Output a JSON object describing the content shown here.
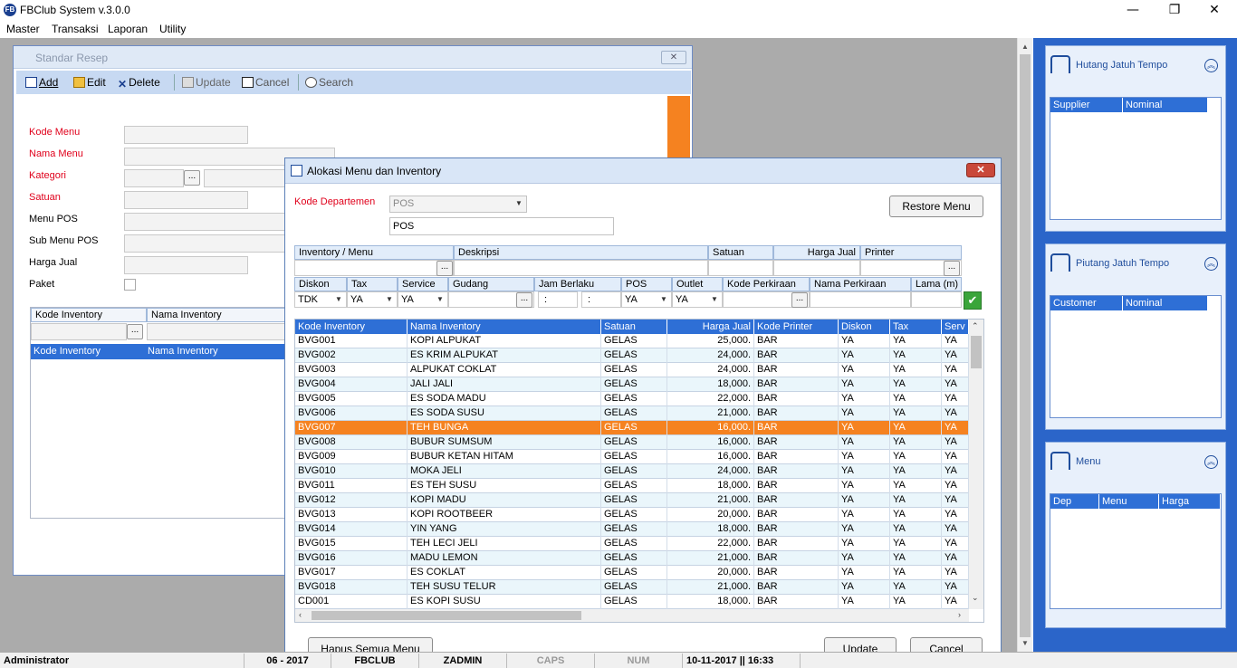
{
  "app": {
    "title": "FBClub System v.3.0.0",
    "min": "—",
    "restore": "❐",
    "close": "✕",
    "icon_text": "FB"
  },
  "menu": [
    "Master",
    "Transaksi",
    "Laporan",
    "Utility"
  ],
  "standar_resep": {
    "title": "Standar Resep",
    "close": "✕",
    "toolbar": {
      "add": "Add",
      "edit": "Edit",
      "delete": "Delete",
      "update": "Update",
      "cancel": "Cancel",
      "search": "Search"
    },
    "fields": {
      "kode_menu": "Kode Menu",
      "nama_menu": "Nama Menu",
      "kategori": "Kategori",
      "satuan": "Satuan",
      "menu_pos": "Menu POS",
      "sub_menu_pos": "Sub Menu POS",
      "harga_jual": "Harga Jual",
      "paket": "Paket"
    },
    "ellipsis": "...",
    "inv_headers": {
      "kode": "Kode Inventory",
      "nama": "Nama Inventory"
    }
  },
  "dialog": {
    "title": "Alokasi Menu dan Inventory",
    "close": "✕",
    "kode_departemen_label": "Kode Departemen",
    "kode_departemen_value": "POS",
    "pos_text": "POS",
    "restore_menu": "Restore Menu",
    "row1_headers": {
      "inventory": "Inventory / Menu",
      "deskripsi": "Deskripsi",
      "satuan": "Satuan",
      "harga_jual": "Harga Jual",
      "printer": "Printer"
    },
    "row2_headers": {
      "diskon": "Diskon",
      "tax": "Tax",
      "service": "Service",
      "gudang": "Gudang",
      "jam": "Jam Berlaku",
      "pos": "POS",
      "outlet": "Outlet",
      "kode_perkiraan": "Kode Perkiraan",
      "nama_perkiraan": "Nama Perkiraan",
      "lama": "Lama (m)"
    },
    "row2_values": {
      "diskon": "TDK",
      "tax": "YA",
      "service": "YA",
      "jam1": ":",
      "jam2": ":",
      "pos": "YA",
      "outlet": "YA"
    },
    "ellipsis": "...",
    "check": "✔",
    "grid_headers": [
      "Kode Inventory",
      "Nama Inventory",
      "Satuan",
      "Harga Jual",
      "Kode Printer",
      "Diskon",
      "Tax",
      "Serv"
    ],
    "grid_rows": [
      [
        "BVG001",
        "KOPI ALPUKAT",
        "GELAS",
        "25,000.",
        "BAR",
        "YA",
        "YA",
        "YA"
      ],
      [
        "BVG002",
        "ES KRIM ALPUKAT",
        "GELAS",
        "24,000.",
        "BAR",
        "YA",
        "YA",
        "YA"
      ],
      [
        "BVG003",
        "ALPUKAT COKLAT",
        "GELAS",
        "24,000.",
        "BAR",
        "YA",
        "YA",
        "YA"
      ],
      [
        "BVG004",
        "JALI JALI",
        "GELAS",
        "18,000.",
        "BAR",
        "YA",
        "YA",
        "YA"
      ],
      [
        "BVG005",
        "ES SODA MADU",
        "GELAS",
        "22,000.",
        "BAR",
        "YA",
        "YA",
        "YA"
      ],
      [
        "BVG006",
        "ES SODA SUSU",
        "GELAS",
        "21,000.",
        "BAR",
        "YA",
        "YA",
        "YA"
      ],
      [
        "BVG007",
        "TEH BUNGA",
        "GELAS",
        "16,000.",
        "BAR",
        "YA",
        "YA",
        "YA"
      ],
      [
        "BVG008",
        "BUBUR SUMSUM",
        "GELAS",
        "16,000.",
        "BAR",
        "YA",
        "YA",
        "YA"
      ],
      [
        "BVG009",
        "BUBUR KETAN HITAM",
        "GELAS",
        "16,000.",
        "BAR",
        "YA",
        "YA",
        "YA"
      ],
      [
        "BVG010",
        "MOKA JELI",
        "GELAS",
        "24,000.",
        "BAR",
        "YA",
        "YA",
        "YA"
      ],
      [
        "BVG011",
        "ES TEH SUSU",
        "GELAS",
        "18,000.",
        "BAR",
        "YA",
        "YA",
        "YA"
      ],
      [
        "BVG012",
        "KOPI MADU",
        "GELAS",
        "21,000.",
        "BAR",
        "YA",
        "YA",
        "YA"
      ],
      [
        "BVG013",
        "KOPI ROOTBEER",
        "GELAS",
        "20,000.",
        "BAR",
        "YA",
        "YA",
        "YA"
      ],
      [
        "BVG014",
        "YIN YANG",
        "GELAS",
        "18,000.",
        "BAR",
        "YA",
        "YA",
        "YA"
      ],
      [
        "BVG015",
        "TEH LECI JELI",
        "GELAS",
        "22,000.",
        "BAR",
        "YA",
        "YA",
        "YA"
      ],
      [
        "BVG016",
        "MADU LEMON",
        "GELAS",
        "21,000.",
        "BAR",
        "YA",
        "YA",
        "YA"
      ],
      [
        "BVG017",
        "ES COKLAT",
        "GELAS",
        "20,000.",
        "BAR",
        "YA",
        "YA",
        "YA"
      ],
      [
        "BVG018",
        "TEH SUSU TELUR",
        "GELAS",
        "21,000.",
        "BAR",
        "YA",
        "YA",
        "YA"
      ],
      [
        "CD001",
        "ES KOPI SUSU",
        "GELAS",
        "18,000.",
        "BAR",
        "YA",
        "YA",
        "YA"
      ]
    ],
    "selected_row": 6,
    "hapus_button": "Hapus Semua Menu",
    "update_button": "Update",
    "cancel_button": "Cancel"
  },
  "right_panels": [
    {
      "title": "Hutang Jatuh Tempo",
      "cols": [
        "Supplier",
        "Nominal"
      ]
    },
    {
      "title": "Piutang Jatuh Tempo",
      "cols": [
        "Customer",
        "Nominal"
      ]
    },
    {
      "title": "Menu",
      "cols": [
        "Dep",
        "Menu",
        "Harga"
      ]
    }
  ],
  "status": {
    "user": "Administrator",
    "period": "06 - 2017",
    "company": "FBCLUB",
    "login": "ZADMIN",
    "caps": "CAPS",
    "num": "NUM",
    "datetime": "10-11-2017 || 16:33"
  },
  "colors": {
    "accent_orange": "#f58220",
    "grid_header": "#2e6fd6",
    "panel_blue": "#2b65c9",
    "required_red": "#e0001b"
  }
}
